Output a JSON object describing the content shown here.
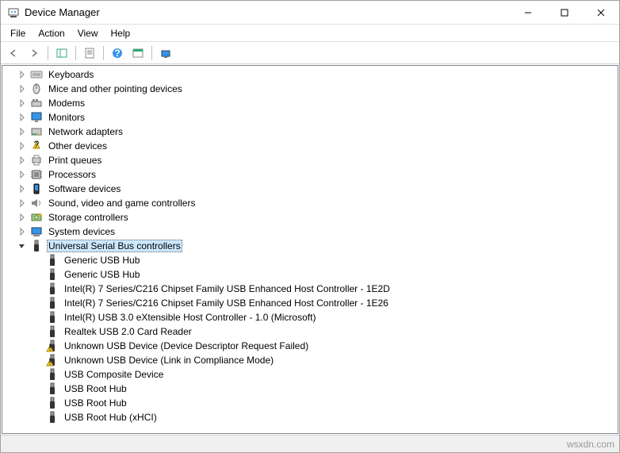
{
  "window": {
    "title": "Device Manager"
  },
  "menubar": {
    "file": "File",
    "action": "Action",
    "view": "View",
    "help": "Help"
  },
  "tree": {
    "categories": [
      {
        "label": "Keyboards",
        "icon": "keyboard",
        "expanded": false
      },
      {
        "label": "Mice and other pointing devices",
        "icon": "mouse",
        "expanded": false
      },
      {
        "label": "Modems",
        "icon": "modem",
        "expanded": false
      },
      {
        "label": "Monitors",
        "icon": "monitor",
        "expanded": false
      },
      {
        "label": "Network adapters",
        "icon": "network",
        "expanded": false
      },
      {
        "label": "Other devices",
        "icon": "other",
        "expanded": false
      },
      {
        "label": "Print queues",
        "icon": "printer",
        "expanded": false
      },
      {
        "label": "Processors",
        "icon": "cpu",
        "expanded": false
      },
      {
        "label": "Software devices",
        "icon": "software",
        "expanded": false
      },
      {
        "label": "Sound, video and game controllers",
        "icon": "sound",
        "expanded": false
      },
      {
        "label": "Storage controllers",
        "icon": "storage",
        "expanded": false
      },
      {
        "label": "System devices",
        "icon": "system",
        "expanded": false
      },
      {
        "label": "Universal Serial Bus controllers",
        "icon": "usb",
        "expanded": true,
        "selected": true,
        "children": [
          {
            "label": "Generic USB Hub",
            "icon": "usb",
            "warn": false
          },
          {
            "label": "Generic USB Hub",
            "icon": "usb",
            "warn": false
          },
          {
            "label": "Intel(R) 7 Series/C216 Chipset Family USB Enhanced Host Controller - 1E2D",
            "icon": "usb",
            "warn": false
          },
          {
            "label": "Intel(R) 7 Series/C216 Chipset Family USB Enhanced Host Controller - 1E26",
            "icon": "usb",
            "warn": false
          },
          {
            "label": "Intel(R) USB 3.0 eXtensible Host Controller - 1.0 (Microsoft)",
            "icon": "usb",
            "warn": false
          },
          {
            "label": "Realtek USB 2.0 Card Reader",
            "icon": "usb",
            "warn": false
          },
          {
            "label": "Unknown USB Device (Device Descriptor Request Failed)",
            "icon": "usb",
            "warn": true
          },
          {
            "label": "Unknown USB Device (Link in Compliance Mode)",
            "icon": "usb",
            "warn": true
          },
          {
            "label": "USB Composite Device",
            "icon": "usb",
            "warn": false
          },
          {
            "label": "USB Root Hub",
            "icon": "usb",
            "warn": false
          },
          {
            "label": "USB Root Hub",
            "icon": "usb",
            "warn": false
          },
          {
            "label": "USB Root Hub (xHCI)",
            "icon": "usb",
            "warn": false
          }
        ]
      }
    ]
  },
  "statusbar": {
    "text": "wsxdn.com"
  }
}
